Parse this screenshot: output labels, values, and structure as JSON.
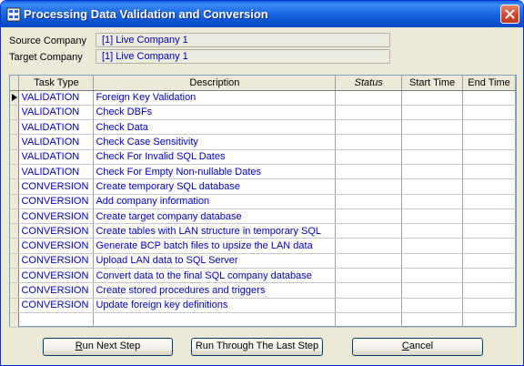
{
  "window": {
    "title": "Processing Data Validation and Conversion"
  },
  "fields": {
    "source_label": "Source Company",
    "source_value": "[1] Live Company 1",
    "target_label": "Target Company",
    "target_value": "[1] Live Company 1"
  },
  "grid": {
    "headers": {
      "task_type": "Task Type",
      "description": "Description",
      "status": "Status",
      "start_time": "Start Time",
      "end_time": "End Time"
    },
    "rows": [
      {
        "task_type": "VALIDATION",
        "description": "Foreign Key Validation",
        "status": "",
        "start_time": "",
        "end_time": ""
      },
      {
        "task_type": "VALIDATION",
        "description": "Check DBFs",
        "status": "",
        "start_time": "",
        "end_time": ""
      },
      {
        "task_type": "VALIDATION",
        "description": "Check Data",
        "status": "",
        "start_time": "",
        "end_time": ""
      },
      {
        "task_type": "VALIDATION",
        "description": "Check Case Sensitivity",
        "status": "",
        "start_time": "",
        "end_time": ""
      },
      {
        "task_type": "VALIDATION",
        "description": "Check For Invalid SQL Dates",
        "status": "",
        "start_time": "",
        "end_time": ""
      },
      {
        "task_type": "VALIDATION",
        "description": "Check For Empty Non-nullable Dates",
        "status": "",
        "start_time": "",
        "end_time": ""
      },
      {
        "task_type": "CONVERSION",
        "description": "Create temporary SQL database",
        "status": "",
        "start_time": "",
        "end_time": ""
      },
      {
        "task_type": "CONVERSION",
        "description": "Add company information",
        "status": "",
        "start_time": "",
        "end_time": ""
      },
      {
        "task_type": "CONVERSION",
        "description": "Create target company database",
        "status": "",
        "start_time": "",
        "end_time": ""
      },
      {
        "task_type": "CONVERSION",
        "description": "Create tables with LAN structure in temporary SQL",
        "status": "",
        "start_time": "",
        "end_time": ""
      },
      {
        "task_type": "CONVERSION",
        "description": "Generate BCP batch files to upsize the LAN data",
        "status": "",
        "start_time": "",
        "end_time": ""
      },
      {
        "task_type": "CONVERSION",
        "description": "Upload LAN data to SQL Server",
        "status": "",
        "start_time": "",
        "end_time": ""
      },
      {
        "task_type": "CONVERSION",
        "description": "Convert data to the final SQL company database",
        "status": "",
        "start_time": "",
        "end_time": ""
      },
      {
        "task_type": "CONVERSION",
        "description": "Create stored procedures and triggers",
        "status": "",
        "start_time": "",
        "end_time": ""
      },
      {
        "task_type": "CONVERSION",
        "description": "Update foreign key definitions",
        "status": "",
        "start_time": "",
        "end_time": ""
      },
      {
        "task_type": "",
        "description": "",
        "status": "",
        "start_time": "",
        "end_time": ""
      }
    ]
  },
  "buttons": {
    "run_next": {
      "underline": "R",
      "rest": "un Next Step"
    },
    "run_through": "Run Through The Last Step",
    "cancel": {
      "underline": "C",
      "rest": "ancel"
    }
  }
}
